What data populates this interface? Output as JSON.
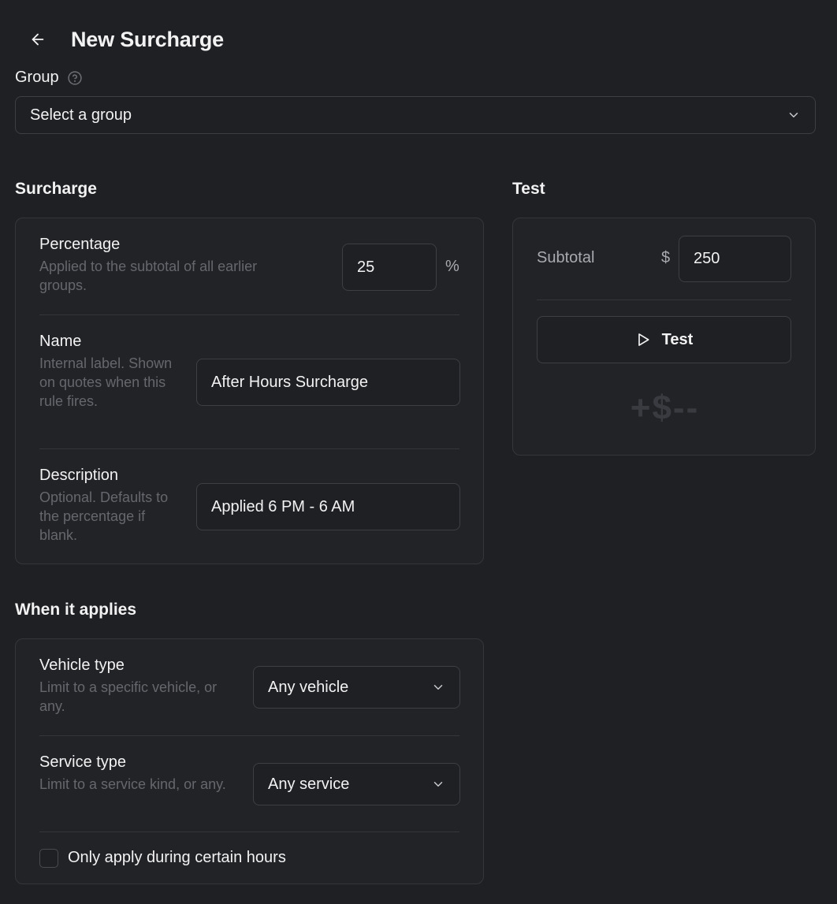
{
  "header": {
    "title": "New Surcharge"
  },
  "group": {
    "label": "Group",
    "selected": "Select a group"
  },
  "surcharge": {
    "title": "Surcharge",
    "percentage": {
      "label": "Percentage",
      "help": "Applied to the subtotal of all earlier groups.",
      "value": "25",
      "unit": "%"
    },
    "name": {
      "label": "Name",
      "help": "Internal label. Shown on quotes when this rule fires.",
      "value": "After Hours Surcharge"
    },
    "description": {
      "label": "Description",
      "help": "Optional. Defaults to the percentage if blank.",
      "value": "Applied 6 PM - 6 AM"
    }
  },
  "applies": {
    "title": "When it applies",
    "vehicle": {
      "label": "Vehicle type",
      "help": "Limit to a specific vehicle, or any.",
      "selected": "Any vehicle"
    },
    "service": {
      "label": "Service type",
      "help": "Limit to a service kind, or any.",
      "selected": "Any service"
    },
    "hours": {
      "label": "Only apply during certain hours",
      "checked": false
    }
  },
  "test": {
    "title": "Test",
    "subtotal_label": "Subtotal",
    "currency": "$",
    "subtotal_value": "250",
    "button_label": "Test",
    "result": "+$--"
  },
  "icons": {
    "back": "arrow-left-icon",
    "help": "question-circle-icon",
    "chevron": "chevron-down-icon",
    "play": "play-icon"
  },
  "colors": {
    "background": "#1f2024",
    "card": "#222327",
    "border": "#3e3f44",
    "muted_text": "#66676d"
  }
}
